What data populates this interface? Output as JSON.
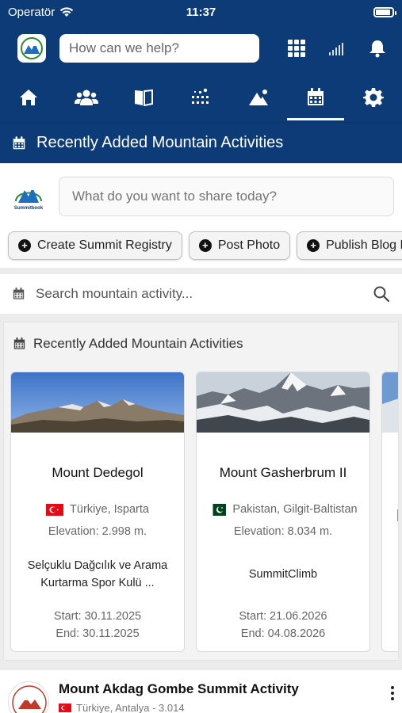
{
  "status_bar": {
    "carrier": "Operatör",
    "time": "11:37"
  },
  "topbar": {
    "search_placeholder": "How can we help?"
  },
  "nav": {
    "items": [
      {
        "icon": "home-icon"
      },
      {
        "icon": "community-icon"
      },
      {
        "icon": "book-icon"
      },
      {
        "icon": "route-icon"
      },
      {
        "icon": "mountain-icon"
      },
      {
        "icon": "calendar-icon",
        "active": true
      },
      {
        "icon": "gear-icon"
      }
    ]
  },
  "section_title": "Recently Added Mountain Activities",
  "share": {
    "placeholder": "What do you want to share today?",
    "logo_text": "Summitbook"
  },
  "chips": [
    {
      "label": "Create Summit Registry"
    },
    {
      "label": "Post Photo"
    },
    {
      "label": "Publish Blog P"
    }
  ],
  "activity_search": {
    "placeholder": "Search mountain activity..."
  },
  "panel": {
    "title": "Recently Added Mountain Activities",
    "cards": [
      {
        "title": "Mount Dedegol",
        "location": "Türkiye, Isparta",
        "flag": "turkey",
        "elevation": "Elevation: 2.998 m.",
        "organizer": "Selçuklu Dağcılık ve Arama Kurtarma Spor Kulü ...",
        "start": "Start: 30.11.2025",
        "end": "End: 30.11.2025"
      },
      {
        "title": "Mount Gasherbrum II",
        "location": "Pakistan, Gilgit-Baltistan",
        "flag": "pakistan",
        "elevation": "Elevation: 8.034 m.",
        "organizer": "SummitClimb",
        "start": "Start: 21.06.2026",
        "end": "End: 04.08.2026"
      }
    ]
  },
  "feed": {
    "title": "Mount Akdag Gombe Summit Activity",
    "subtitle": "Türkiye, Antalya - 3.014"
  },
  "colors": {
    "primary": "#0c3b78",
    "background": "#ececec",
    "turkey_red": "#e30a17",
    "pakistan_green": "#01411c"
  }
}
